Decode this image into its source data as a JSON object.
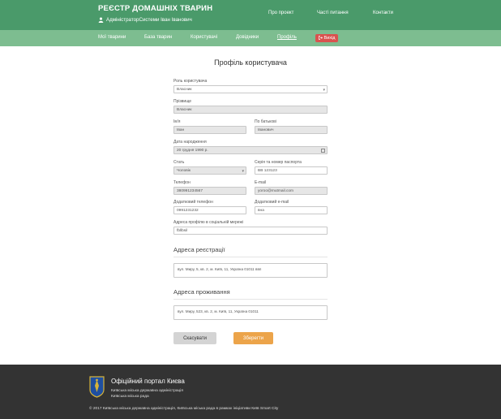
{
  "header": {
    "brand": "РЕЄСТР ДОМАШНІХ ТВАРИН",
    "admin_label": "АдміністраторСистеми Іван Іванович",
    "top_links": [
      "Про проект",
      "Часті питання",
      "Контакти"
    ]
  },
  "nav": {
    "items": [
      "Мої тварини",
      "База тварин",
      "Користувачі",
      "Довідники",
      "Профіль"
    ],
    "active": "Профіль",
    "exit_label": "Вихід"
  },
  "page": {
    "title": "Профіль користувача"
  },
  "form": {
    "role": {
      "label": "Роль користувача",
      "value": "Власник"
    },
    "surname": {
      "label": "Прізвище",
      "value": "Власник"
    },
    "name": {
      "label": "Ім'я",
      "value": "Іван"
    },
    "patronymic": {
      "label": "По батькові",
      "value": "Іванович"
    },
    "birthdate": {
      "label": "Дата народження",
      "value": "20 грудня 1990 р."
    },
    "sex": {
      "label": "Стать",
      "value": "Чоловік"
    },
    "passport": {
      "label": "Серія та номер паспорта",
      "value": "ВВ 123123"
    },
    "phone": {
      "label": "Телефон",
      "value": "380991234567"
    },
    "email": {
      "label": "E-mail",
      "value": "yoroo@mutmail.com"
    },
    "phone2": {
      "label": "Додатковий телефон",
      "value": "0991231232"
    },
    "email2": {
      "label": "Додатковий e-mail",
      "value": "вна"
    },
    "social": {
      "label": "Адреса профілю в соціальній мережі",
      "value": "fbllbsil"
    }
  },
  "registration": {
    "title": "Адреса реєстрації",
    "value": "вул. Миру, 5, кв. 2, м. Київ, 11, Україна 01011 ввп"
  },
  "residence": {
    "title": "Адреса проживання",
    "value": "вул. Миру, 523, кв. 2, м. Київ, 11, Україна 01011"
  },
  "buttons": {
    "cancel": "Скасувати",
    "save": "Зберегти"
  },
  "footer": {
    "portal": "Офіційний портал Києва",
    "line1": "Київська міська державна адміністрація",
    "line2": "Київська міська рада",
    "copyright": "© 2017 Київська міська державна адміністрація, Київська міська рада в рамках ініціативи Київ Smart City"
  },
  "colors": {
    "header": "#4a9a6a",
    "nav": "#7dbd90",
    "exit": "#d9534f",
    "save": "#eca44a",
    "footer": "#333333"
  }
}
